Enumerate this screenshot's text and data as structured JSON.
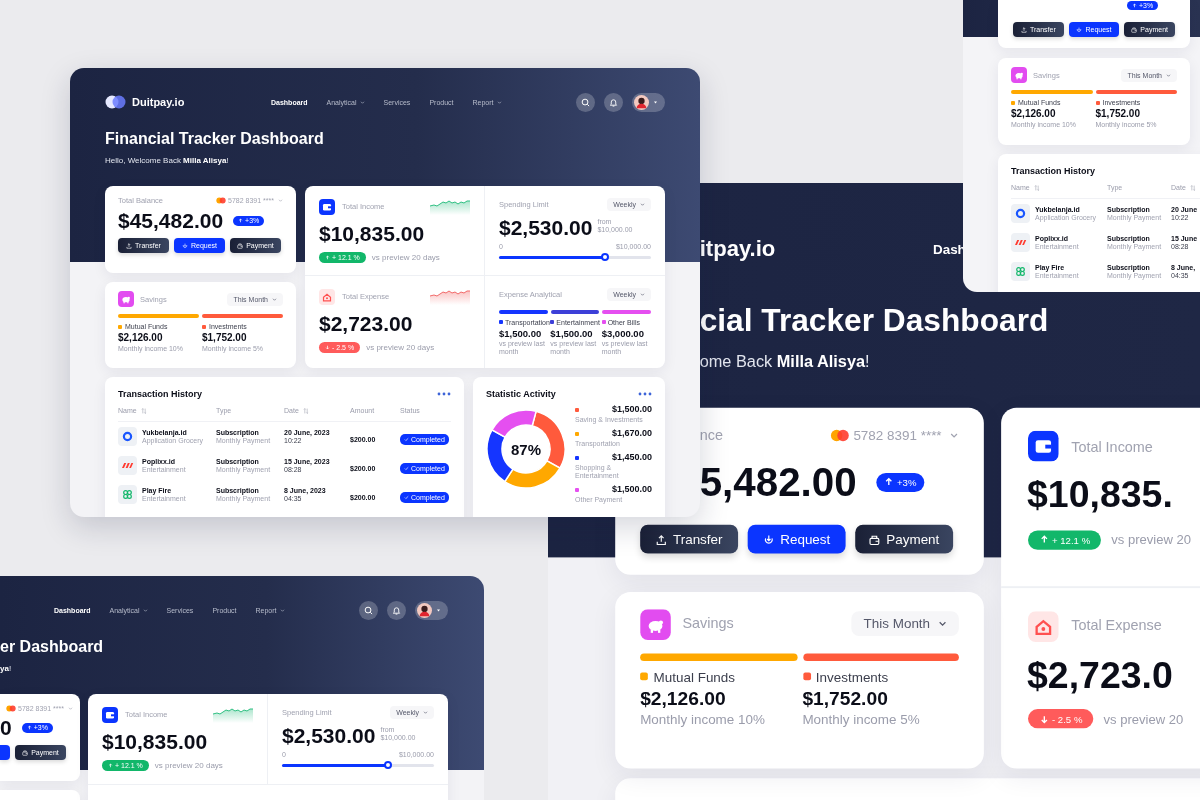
{
  "main_view": {
    "brand": "Duitpay.io",
    "nav": [
      {
        "label": "Dashboard",
        "selected": true,
        "dropdown": false
      },
      {
        "label": "Analytical",
        "selected": false,
        "dropdown": true
      },
      {
        "label": "Services",
        "selected": false,
        "dropdown": false
      },
      {
        "label": "Product",
        "selected": false,
        "dropdown": false
      },
      {
        "label": "Report",
        "selected": false,
        "dropdown": true
      }
    ],
    "title": "Financial Tracker Dashboard",
    "greeting": "Hello, Welcome Back **Milla Alisya**!",
    "balance": {
      "label": "Total Balance",
      "card_number": "5782 8391 ****",
      "amount": "$45,482.00",
      "change": "+3%",
      "buttons": [
        {
          "label": "Transfer",
          "kind": "transfer"
        },
        {
          "label": "Request",
          "kind": "request"
        },
        {
          "label": "Payment",
          "kind": "payment"
        }
      ]
    },
    "income": {
      "label": "Total Income",
      "amount": "$10,835.00",
      "change": "+ 12.1 %",
      "comparison": "vs preview 20 days"
    },
    "spending_limit": {
      "label": "Spending Limit",
      "period": "Weekly",
      "amount": "$2,530.00",
      "from_label": "from",
      "from_amount": "$10,000.00",
      "min": "0",
      "max": "$10,000.00",
      "level": 0.7
    },
    "expense": {
      "label": "Total Expense",
      "amount": "$2,723.00",
      "change": "- 2.5 %",
      "comparison": "vs preview 20 days"
    },
    "expense_analytical": {
      "label": "Expense Analytical",
      "period": "Weekly",
      "categories": [
        {
          "name": "Transportation",
          "amount": "$1,500.00",
          "note": "vs preview last month",
          "color": "#1535ff"
        },
        {
          "name": "Entertainment",
          "amount": "$1,500.00",
          "note": "vs preview last month",
          "color": "#3d3fd8"
        },
        {
          "name": "Other Bills",
          "amount": "$3,000.00",
          "note": "vs preview last month",
          "color": "#e54ff0"
        }
      ]
    },
    "savings": {
      "label": "Savings",
      "period": "This Month",
      "funds": [
        {
          "name": "Mutual Funds",
          "amount": "$2,126.00",
          "note": "Monthly income 10%",
          "color": "#ffa800"
        },
        {
          "name": "Investments",
          "amount": "$1,752.00",
          "note": "Monthly income 5%",
          "color": "#ff5a3c"
        }
      ]
    },
    "transactions": {
      "title": "Transaction History",
      "columns": [
        {
          "label": "Name",
          "sortable": true
        },
        {
          "label": "Type",
          "sortable": false
        },
        {
          "label": "Date",
          "sortable": true
        },
        {
          "label": "Amount",
          "sortable": false
        },
        {
          "label": "Status",
          "sortable": false
        }
      ],
      "rows": [
        {
          "kind": "grocery",
          "name": "Yukbelanja.id",
          "category": "Application Grocery",
          "type": "Subscription",
          "type_note": "Monthly Payment",
          "date": "20 June, 2023",
          "time": "10:22",
          "amount": "$200.00",
          "status": "Completed"
        },
        {
          "kind": "entertainment",
          "name": "Poplixx.id",
          "category": "Entertainment",
          "type": "Subscription",
          "type_note": "Monthly Payment",
          "date": "15 June, 2023",
          "time": "08:28",
          "amount": "$200.00",
          "status": "Completed"
        },
        {
          "kind": "game",
          "name": "Play Fire",
          "category": "Entertainment",
          "type": "Subscription",
          "type_note": "Monthly Payment",
          "date": "8 June, 2023",
          "time": "04:35",
          "amount": "$200.00",
          "status": "Completed"
        }
      ]
    },
    "statistic": {
      "title": "Statistic Activity",
      "center_label": "87%",
      "legend": [
        {
          "amount": "$1,500.00",
          "color": "#ff5a3c"
        },
        {
          "amount": "$1,670.00",
          "color": "#ffa800"
        },
        {
          "amount": "$1,450.00",
          "color": "#1535ff"
        },
        {
          "amount": "$1,500.00",
          "color": "#e54ff0"
        }
      ],
      "chart_data": {
        "type": "donut",
        "categories": [
          "Saving & Investments",
          "Transportation",
          "Shopping & Entertainment",
          "Other Payment"
        ],
        "values": [
          29,
          26,
          24,
          21
        ]
      }
    }
  },
  "zoom_view": {
    "brand": "itpay.io",
    "nav": [
      {
        "label": "Dash",
        "selected": true,
        "dropdown": false
      }
    ],
    "title": "cial Tracker Dashboard",
    "greeting": "ome Back **Milla Alisya**!",
    "balance": {
      "label": "nce",
      "card_number": "5782 8391 ****",
      "amount": "5,482.00",
      "change": "+3%",
      "buttons": [
        {
          "label": "Transfer",
          "kind": "transfer"
        },
        {
          "label": "Request",
          "kind": "request"
        },
        {
          "label": "Payment",
          "kind": "payment"
        }
      ]
    },
    "income": {
      "label": "Total Income",
      "amount": "$10,835.",
      "change": "+ 12.1 %",
      "comparison": "vs preview 20"
    },
    "expense": {
      "label": "Total Expense",
      "amount": "$2,723.0",
      "change": "- 2.5 %",
      "comparison": "vs preview 20"
    },
    "savings": {
      "label": "Savings",
      "period": "This Month",
      "funds": [
        {
          "name": "Mutual Funds",
          "amount": "$2,126.00",
          "note": "Monthly income 10%",
          "color": "#ffa800"
        },
        {
          "name": "Investments",
          "amount": "$1,752.00",
          "note": "Monthly income 5%",
          "color": "#ff5a3c"
        }
      ]
    }
  },
  "top_right_view": {
    "balance": {
      "change": "+3%",
      "buttons": [
        {
          "label": "Transfer",
          "kind": "transfer"
        },
        {
          "label": "Request",
          "kind": "request"
        },
        {
          "label": "Payment",
          "kind": "payment"
        }
      ]
    },
    "savings": {
      "label": "Savings",
      "period": "This Month",
      "funds": [
        {
          "name": "Mutual Funds",
          "amount": "$2,126.00",
          "note": "Monthly income 10%",
          "color": "#ffa800"
        },
        {
          "name": "Investments",
          "amount": "$1,752.00",
          "note": "Monthly income 5%",
          "color": "#ff5a3c"
        }
      ]
    },
    "transactions": {
      "title": "Transaction History",
      "columns": [
        {
          "label": "Name",
          "sortable": true
        },
        {
          "label": "Type",
          "sortable": false
        },
        {
          "label": "Date",
          "sortable": true
        }
      ],
      "rows": [
        {
          "kind": "grocery",
          "name": "Yukbelanja.id",
          "category": "Application Grocery",
          "type": "Subscription",
          "type_note": "Monthly Payment",
          "date": "20 June",
          "time": "10:22"
        },
        {
          "kind": "entertainment",
          "name": "Poplixx.id",
          "category": "Entertainment",
          "type": "Subscription",
          "type_note": "Monthly Payment",
          "date": "15 June",
          "time": "08:28"
        },
        {
          "kind": "game",
          "name": "Play Fire",
          "category": "Entertainment",
          "type": "Subscription",
          "type_note": "Monthly Payment",
          "date": "8 June,",
          "time": "04:35"
        }
      ]
    }
  },
  "bottom_left_view": {
    "nav": [
      {
        "label": "Dashboard",
        "selected": true,
        "dropdown": false
      },
      {
        "label": "Analytical",
        "selected": false,
        "dropdown": true
      },
      {
        "label": "Services",
        "selected": false,
        "dropdown": false
      },
      {
        "label": "Product",
        "selected": false,
        "dropdown": false
      },
      {
        "label": "Report",
        "selected": false,
        "dropdown": true
      }
    ],
    "title": "er Dashboard",
    "greeting": "**ya**!",
    "balance": {
      "card_number": "5782 8391 ****",
      "amount": "0",
      "change": "+3%",
      "buttons": [
        {
          "kind": "request"
        },
        {
          "label": "Payment",
          "kind": "payment"
        }
      ]
    },
    "income": {
      "label": "Total Income",
      "amount": "$10,835.00",
      "change": "+ 12.1 %",
      "comparison": "vs preview 20 days"
    },
    "spending_limit": {
      "label": "Spending Limit",
      "period": "Weekly",
      "amount": "$2,530.00",
      "from_label": "from",
      "from_amount": "$10,000.00",
      "min": "0",
      "max": "$10,000.00",
      "level": 0.7
    }
  }
}
